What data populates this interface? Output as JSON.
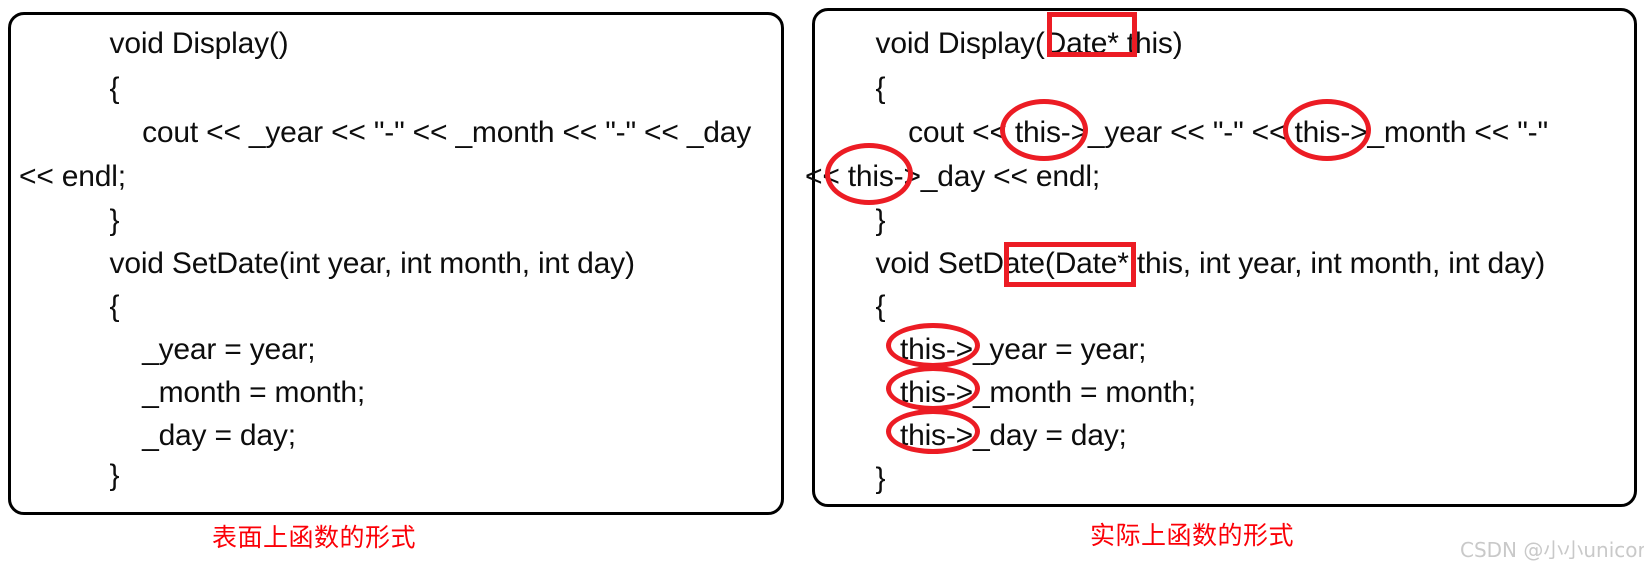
{
  "figure": {
    "title_left_caption": "表面上函数的形式",
    "title_right_caption": "实际上函数的形式",
    "watermark": "CSDN @小小unicorn",
    "accent_color": "#ec1c24",
    "caption_color": "#fb0007",
    "border_color": "#000000",
    "text_color": "#0d0d0d"
  },
  "left_panel": {
    "name": "surface-form-code-box",
    "lines": [
      "    void Display()",
      "    {",
      "        cout << _year << \"-\" << _month << \"-\" << _day",
      "<< endl;",
      "    }",
      "    void SetDate(int year, int month, int day)",
      "    {",
      "        _year = year;",
      "        _month = month;",
      "        _day = day;",
      "    }"
    ]
  },
  "right_panel": {
    "name": "actual-form-code-box",
    "lines": [
      "    void Display(Date* this)",
      "    {",
      "        cout << this->_year << \"-\" << this->_month << \"-\"",
      "<< this->_day << endl;",
      "    }",
      "    void SetDate(Date* this, int year, int month, int day)",
      "    {",
      "       this->_year = year;",
      "       this->_month = month;",
      "       this->_day = day;",
      "    }"
    ],
    "annotations": [
      {
        "shape": "rect",
        "target": "Date* this)"
      },
      {
        "shape": "ellipse",
        "target": "this->"
      },
      {
        "shape": "ellipse",
        "target": "this->"
      },
      {
        "shape": "ellipse",
        "target": "this->"
      },
      {
        "shape": "rect",
        "target": "Date* this,"
      },
      {
        "shape": "ellipse",
        "target": "this->"
      },
      {
        "shape": "ellipse",
        "target": "this->"
      },
      {
        "shape": "ellipse",
        "target": "this->"
      }
    ]
  }
}
